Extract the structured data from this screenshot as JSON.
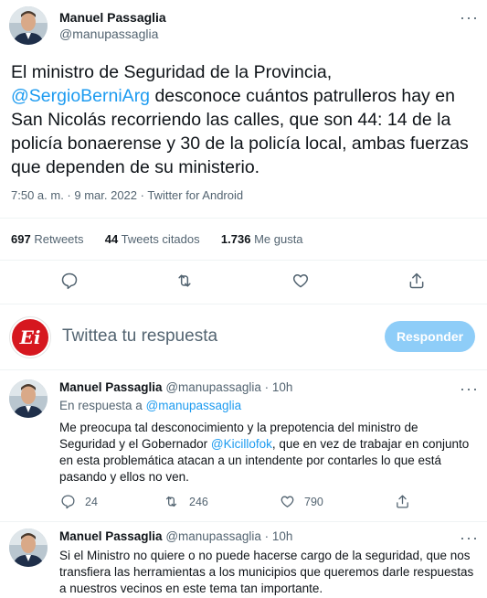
{
  "main_tweet": {
    "author_name": "Manuel Passaglia",
    "author_handle": "@manupassaglia",
    "more_label": "···",
    "text_1": "El ministro de Seguridad de la Provincia,",
    "mention": "@SergioBerniArg",
    "text_2": " desconoce cuántos patrulleros hay en San Nicolás recorriendo las calles, que son 44: 14 de la policía bonaerense y 30 de la policía local, ambas fuerzas que dependen de su ministerio.",
    "timestamp": "7:50 a. m. · 9 mar. 2022 · Twitter for Android",
    "stats": {
      "retweets_count": "697",
      "retweets_label": "Retweets",
      "quotes_count": "44",
      "quotes_label": "Tweets citados",
      "likes_count": "1.736",
      "likes_label": "Me gusta"
    }
  },
  "composer": {
    "avatar_text": "Ei",
    "placeholder": "Twittea tu respuesta",
    "button_label": "Responder"
  },
  "replies": [
    {
      "author_name": "Manuel Passaglia",
      "author_handle": "@manupassaglia",
      "time": "· 10h",
      "more_label": "···",
      "replying_prefix": "En respuesta a ",
      "replying_handle": "@manupassaglia",
      "text_1": "Me preocupa tal desconocimiento y la prepotencia del ministro de Seguridad y el Gobernador ",
      "mention": "@Kicillofok",
      "text_2": ", que en vez de trabajar en conjunto en esta problemática atacan a un intendente por contarles lo que está pasando y ellos no ven.",
      "reply_count": "24",
      "retweet_count": "246",
      "like_count": "790"
    },
    {
      "author_name": "Manuel Passaglia",
      "author_handle": "@manupassaglia",
      "time": "· 10h",
      "more_label": "···",
      "text": "Si el Ministro no quiere o no puede hacerse cargo de la seguridad, que nos transfiera las herramientas a los municipios que queremos darle respuestas a nuestros vecinos en este tema tan importante."
    }
  ]
}
